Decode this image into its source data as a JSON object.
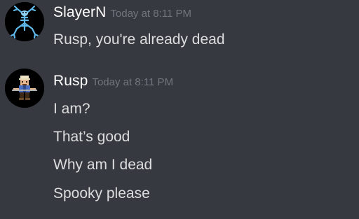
{
  "messages": [
    {
      "username": "SlayerN",
      "timestamp": "Today at 8:11 PM",
      "avatar_icon": "blue-frog-skeleton-avatar",
      "lines": [
        "Rusp, you're already dead"
      ]
    },
    {
      "username": "Rusp",
      "timestamp": "Today at 8:11 PM",
      "avatar_icon": "pixel-character-avatar",
      "lines": [
        "I am?",
        "That’s good",
        "Why am I dead",
        "Spooky please"
      ]
    }
  ],
  "colors": {
    "background": "#36393f",
    "username": "#ffffff",
    "timestamp": "#72767d",
    "message_text": "#dcddde"
  }
}
